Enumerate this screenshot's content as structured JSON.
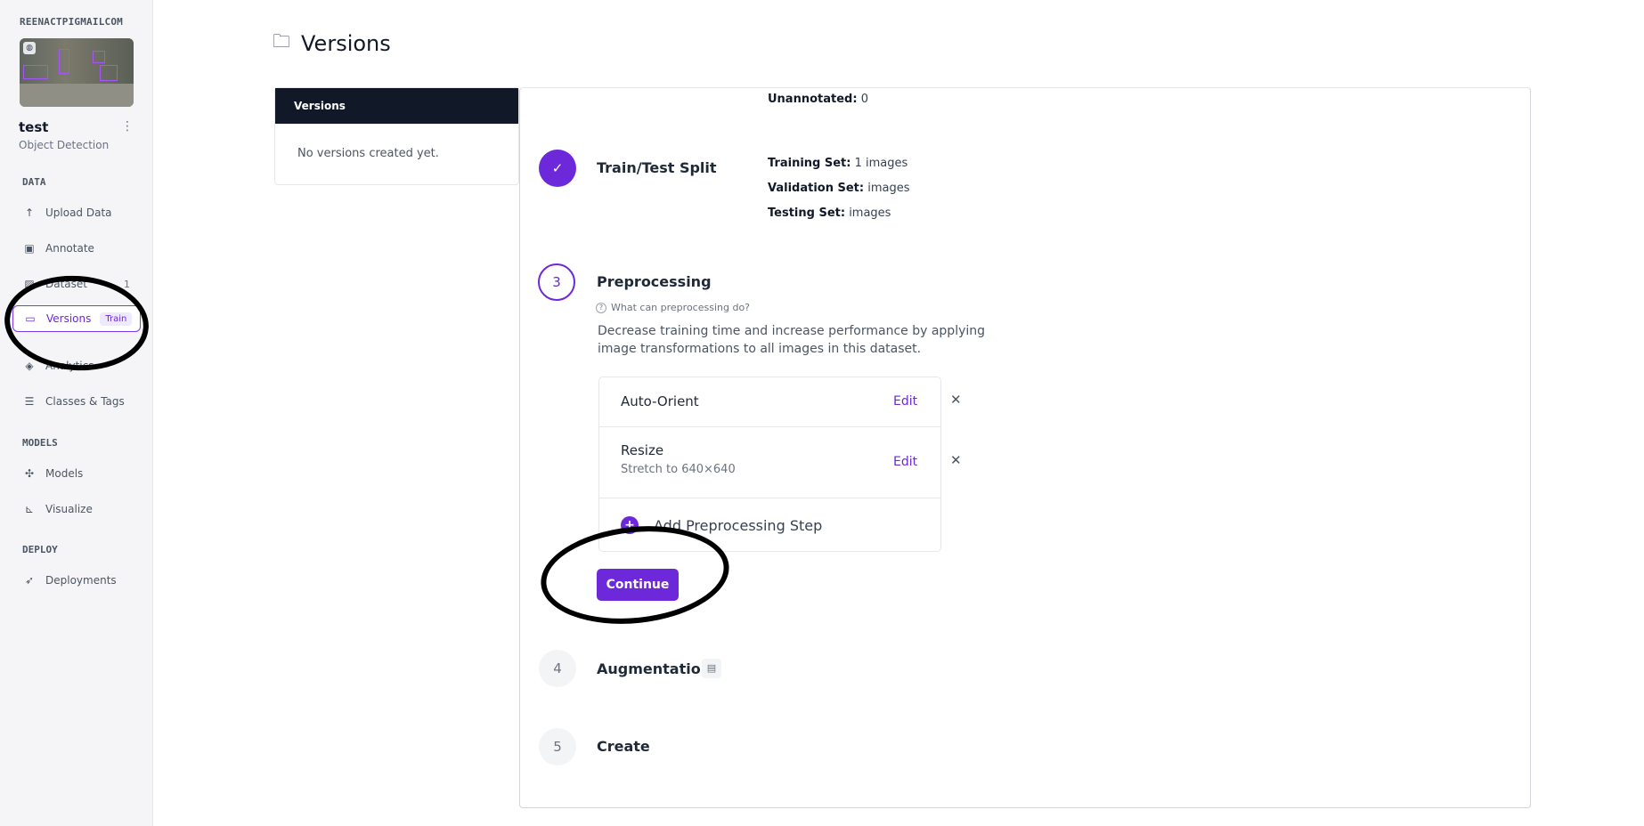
{
  "sidebar": {
    "account": "REENACTPIGMAILCOM",
    "project_name": "test",
    "project_type": "Object Detection",
    "more_icon": "kebab-icon",
    "sections": {
      "data": "DATA",
      "models": "MODELS",
      "deploy": "DEPLOY"
    },
    "items": {
      "upload": "Upload Data",
      "annotate": "Annotate",
      "dataset": "Dataset",
      "dataset_count": "1",
      "versions": "Versions",
      "versions_badge": "Train",
      "analytics": "Analytics",
      "classes": "Classes & Tags",
      "models": "Models",
      "visualize": "Visualize",
      "deployments": "Deployments"
    }
  },
  "header": {
    "title": "Versions"
  },
  "versions_panel": {
    "title": "Versions",
    "empty_text": "No versions created yet."
  },
  "summary": {
    "unannotated_label": "Unannotated:",
    "unannotated_value": "0"
  },
  "steps": {
    "split": {
      "title": "Train/Test Split",
      "training_label": "Training Set:",
      "training_value": "1 images",
      "validation_label": "Validation Set:",
      "validation_value": "images",
      "testing_label": "Testing Set:",
      "testing_value": "images"
    },
    "preprocessing": {
      "number": "3",
      "title": "Preprocessing",
      "help": "What can preprocessing do?",
      "description": "Decrease training time and increase performance by applying image transformations to all images in this dataset.",
      "items": [
        {
          "name": "Auto-Orient",
          "detail": "",
          "edit": "Edit"
        },
        {
          "name": "Resize",
          "detail": "Stretch to 640×640",
          "edit": "Edit"
        }
      ],
      "add_step": "Add Preprocessing Step",
      "continue": "Continue"
    },
    "augmentation": {
      "number": "4",
      "title": "Augmentation"
    },
    "create": {
      "number": "5",
      "title": "Create"
    }
  },
  "colors": {
    "accent": "#6d28d9",
    "header_dark": "#111827"
  }
}
